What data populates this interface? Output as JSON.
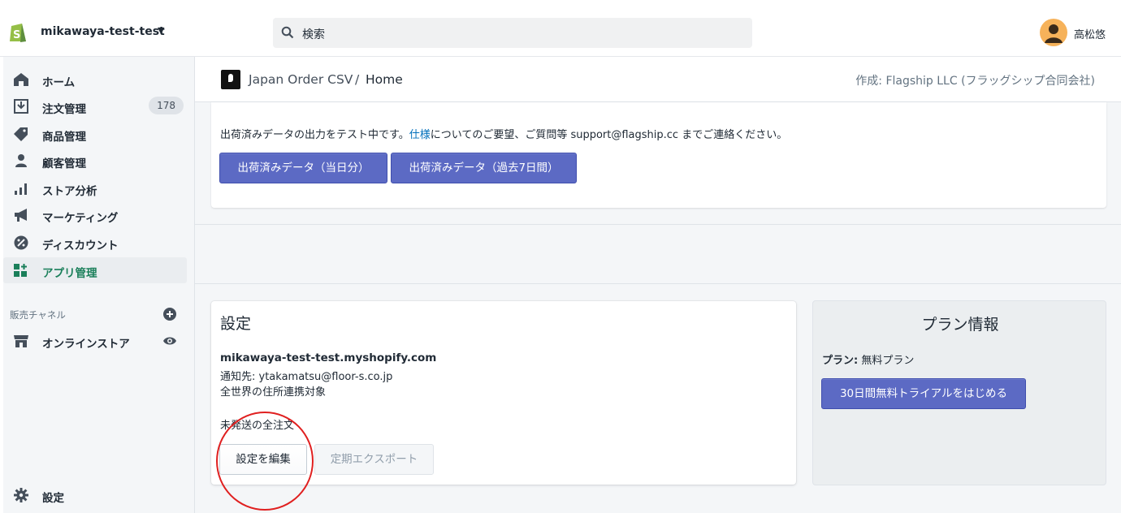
{
  "topbar": {
    "store_name": "mikawaya-test-test",
    "search_placeholder": "検索",
    "user_name": "高松悠"
  },
  "sidebar": {
    "items": [
      {
        "label": "ホーム",
        "icon": "home-icon"
      },
      {
        "label": "注文管理",
        "icon": "orders-icon",
        "badge": "178"
      },
      {
        "label": "商品管理",
        "icon": "tag-icon"
      },
      {
        "label": "顧客管理",
        "icon": "person-icon"
      },
      {
        "label": "ストア分析",
        "icon": "analytics-icon"
      },
      {
        "label": "マーケティング",
        "icon": "megaphone-icon"
      },
      {
        "label": "ディスカウント",
        "icon": "discount-icon"
      },
      {
        "label": "アプリ管理",
        "icon": "apps-icon",
        "active": true
      }
    ],
    "sales_channels_label": "販売チャネル",
    "online_store_label": "オンラインストア",
    "settings_label": "設定"
  },
  "app_header": {
    "app_name": "Japan Order CSV",
    "separator": "/",
    "page": "Home",
    "developer": "作成: Flagship LLC (フラッグシップ合同会社)"
  },
  "shipped_card": {
    "text_before": "出荷済みデータの出力をテスト中です。",
    "link_text": "仕様",
    "text_after": "についてのご要望、ご質問等 support@flagship.cc までご連絡ください。",
    "btn_today": "出荷済みデータ（当日分）",
    "btn_7days": "出荷済みデータ（過去7日間）"
  },
  "settings_card": {
    "title": "設定",
    "shop_domain": "mikawaya-test-test.myshopify.com",
    "notify": "通知先: ytakamatsu@floor-s.co.jp",
    "scope": "全世界の住所連携対象",
    "orders": "未発送の全注文",
    "edit_button": "設定を編集",
    "export_button": "定期エクスポート"
  },
  "plan_card": {
    "title": "プラン情報",
    "plan_label": "プラン:",
    "plan_value": "無料プラン",
    "trial_button": "30日間無料トライアルをはじめる"
  },
  "colors": {
    "primary": "#5c6ac4",
    "active_nav": "#1a7f5a",
    "link": "#006fbb",
    "annotation_circle": "#e02020"
  }
}
